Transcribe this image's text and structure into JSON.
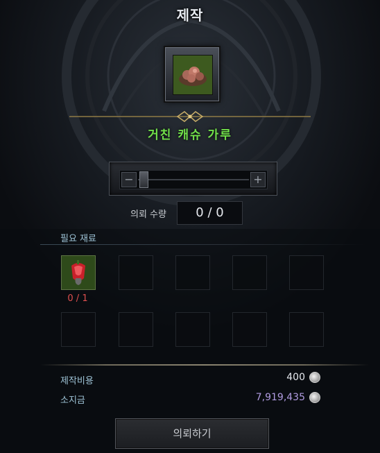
{
  "title": "제작",
  "item": {
    "name": "거친 캐슈 가루",
    "icon": "ground-cashew-powder-icon"
  },
  "quantity": {
    "label": "의뢰 수량",
    "value": "0 / 0",
    "slider_minus": "−",
    "slider_plus": "+"
  },
  "materials": {
    "label": "필요 재료",
    "slots": [
      {
        "icon": "red-cashew-fruit-icon",
        "count": "0 / 1"
      }
    ]
  },
  "cost": {
    "label": "제작비용",
    "value": "400",
    "coin_icon": "silver-coin-icon"
  },
  "balance": {
    "label": "소지금",
    "value": "7,919,435",
    "coin_icon": "silver-coin-icon"
  },
  "colors": {
    "item_name": "#71e04a",
    "balance_value": "#b09be0",
    "count_deficit": "#e05050"
  },
  "action_button": {
    "label": "의뢰하기"
  }
}
